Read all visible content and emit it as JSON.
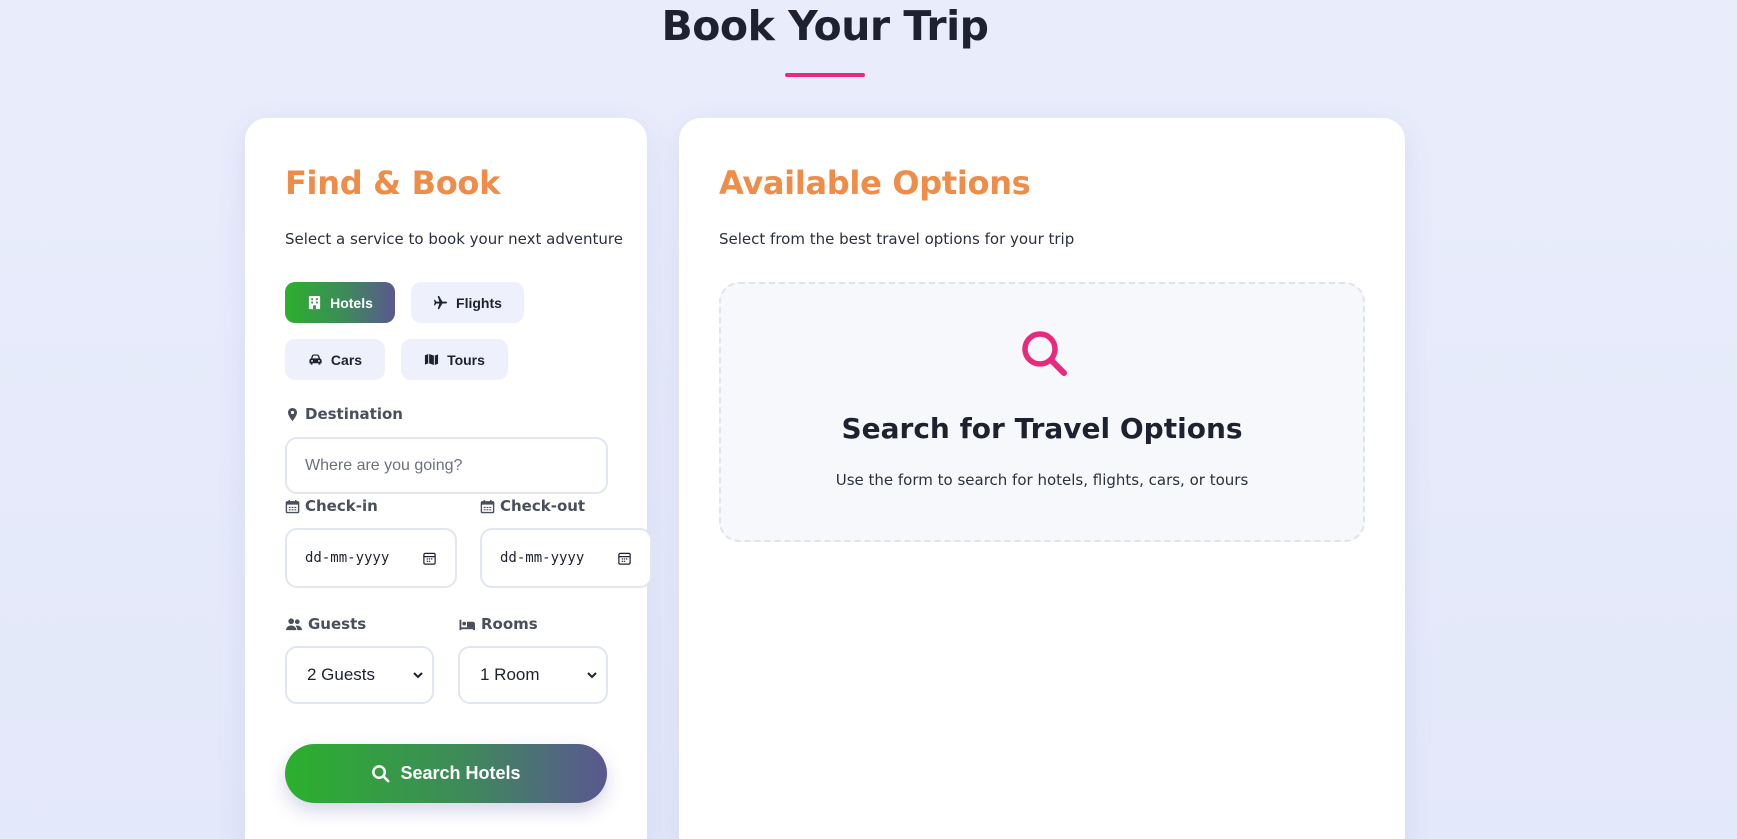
{
  "page": {
    "title": "Book Your Trip"
  },
  "colors": {
    "accent_orange": "#ee8c48",
    "accent_pink": "#e9297d",
    "gradient_green": "#2bb02d",
    "gradient_purple": "#5a5790"
  },
  "booking_form": {
    "heading": "Find & Book",
    "subtitle": "Select a service to book your next adventure",
    "services": [
      {
        "label": "Hotels",
        "icon": "building-icon",
        "active": true
      },
      {
        "label": "Flights",
        "icon": "plane-icon",
        "active": false
      },
      {
        "label": "Cars",
        "icon": "car-icon",
        "active": false
      },
      {
        "label": "Tours",
        "icon": "map-icon",
        "active": false
      }
    ],
    "destination": {
      "label": "Destination",
      "icon": "map-pin-icon",
      "placeholder": "Where are you going?",
      "value": ""
    },
    "check_in": {
      "label": "Check-in",
      "icon": "calendar-icon",
      "placeholder": "dd-mm-yyyy"
    },
    "check_out": {
      "label": "Check-out",
      "icon": "calendar-icon",
      "placeholder": "dd-mm-yyyy"
    },
    "guests": {
      "label": "Guests",
      "icon": "users-icon",
      "selected": "2 Guests"
    },
    "rooms": {
      "label": "Rooms",
      "icon": "bed-icon",
      "selected": "1 Room"
    },
    "search_button": {
      "label": "Search Hotels",
      "icon": "search-icon"
    }
  },
  "results": {
    "heading": "Available Options",
    "subtitle": "Select from the best travel options for your trip",
    "empty_state": {
      "icon": "search-icon",
      "title": "Search for Travel Options",
      "text": "Use the form to search for hotels, flights, cars, or tours"
    }
  }
}
